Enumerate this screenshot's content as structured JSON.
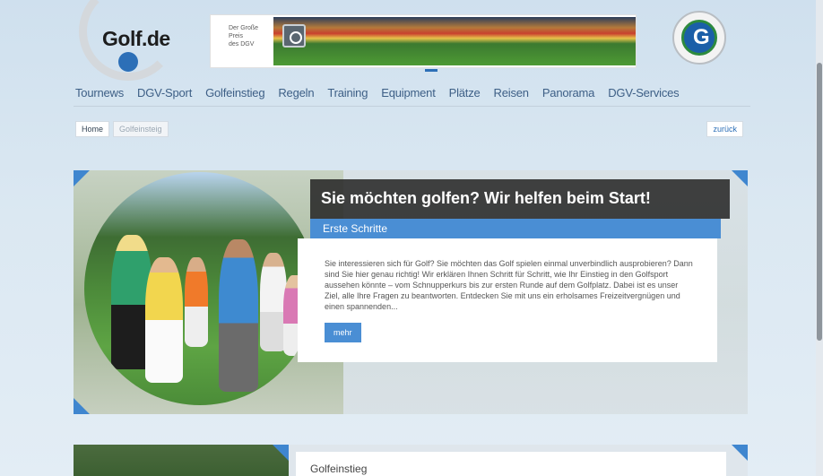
{
  "header": {
    "logo_text": "Golf.de",
    "banner": {
      "lines": [
        "Der Große",
        "Preis",
        "des DGV"
      ]
    }
  },
  "nav": {
    "items": [
      "Tournews",
      "DGV-Sport",
      "Golfeinstieg",
      "Regeln",
      "Training",
      "Equipment",
      "Plätze",
      "Reisen",
      "Panorama",
      "DGV-Services"
    ]
  },
  "breadcrumb": {
    "home": "Home",
    "current": "Golfeinsteig",
    "back": "zurück"
  },
  "hero": {
    "title": "Sie möchten golfen? Wir helfen beim Start!",
    "subtitle": "Erste Schritte",
    "text": "Sie interessieren sich für Golf? Sie möchten das Golf spielen einmal unverbindlich ausprobieren? Dann sind Sie hier genau richtig! Wir erklären Ihnen Schritt für Schritt, wie Ihr Einstieg in den Golfsport aussehen könnte – vom Schnupperkurs bis zur ersten Runde auf dem Golfplatz. Dabei ist es unser Ziel, alle Ihre Fragen zu beantworten. Entdecken Sie mit uns ein erholsames Freizeitvergnügen und einen spannenden...",
    "button": "mehr"
  },
  "card2": {
    "title": "Golfeinstieg"
  },
  "colors": {
    "accent": "#4a8ed4",
    "nav": "#3d5f86",
    "logo_dot": "#2c6fb7"
  }
}
